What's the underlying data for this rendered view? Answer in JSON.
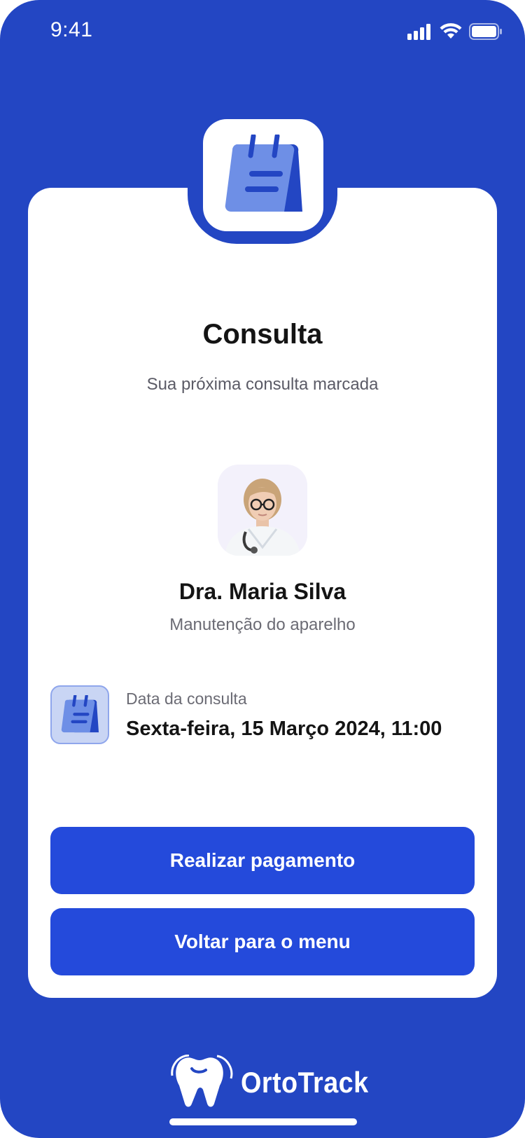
{
  "status_bar": {
    "time": "9:41"
  },
  "card": {
    "title": "Consulta",
    "subtitle": "Sua próxima consulta marcada"
  },
  "doctor": {
    "name": "Dra. Maria Silva",
    "specialty": "Manutenção do aparelho"
  },
  "appointment": {
    "label": "Data da consulta",
    "date": "Sexta-feira, 15 Março 2024, 11:00"
  },
  "buttons": {
    "pay": "Realizar pagamento",
    "menu": "Voltar para o menu"
  },
  "brand": {
    "name": "OrtoTrack"
  },
  "colors": {
    "background": "#2346C3",
    "button": "#244ADB",
    "card": "#FFFFFF"
  }
}
